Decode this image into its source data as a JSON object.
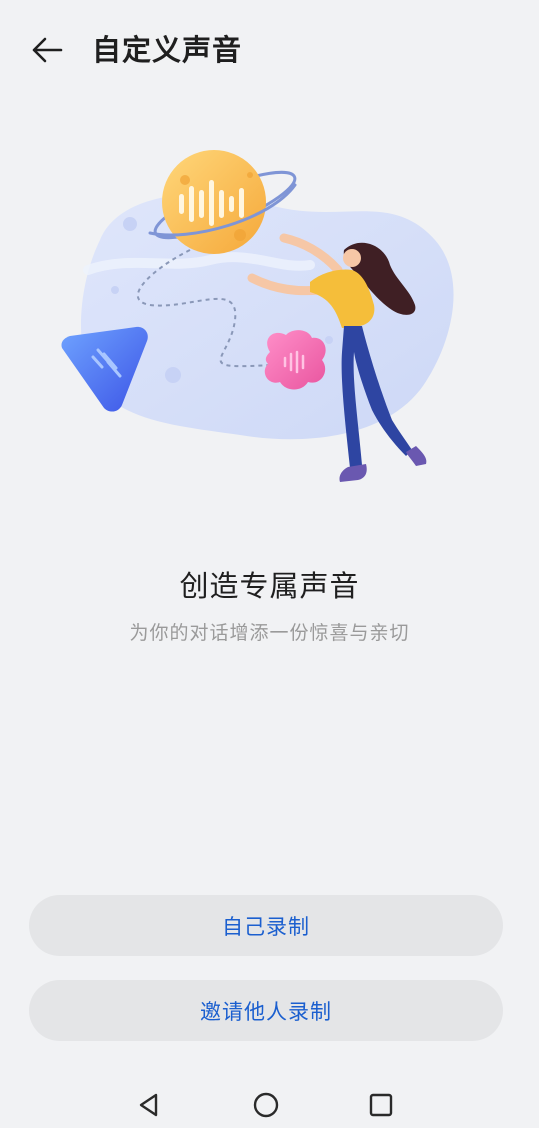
{
  "header": {
    "title": "自定义声音",
    "back_icon": "arrow-left-icon"
  },
  "hero": {
    "headline": "创造专属声音",
    "subline": "为你的对话增添一份惊喜与亲切"
  },
  "actions": {
    "record_self_label": "自己录制",
    "invite_label": "邀请他人录制"
  },
  "navbar": {
    "back_icon": "triangle-back-icon",
    "home_icon": "circle-home-icon",
    "recent_icon": "square-recents-icon"
  },
  "colors": {
    "background": "#f1f2f4",
    "accent": "#1b5fcf",
    "button_bg": "#e4e5e7"
  }
}
